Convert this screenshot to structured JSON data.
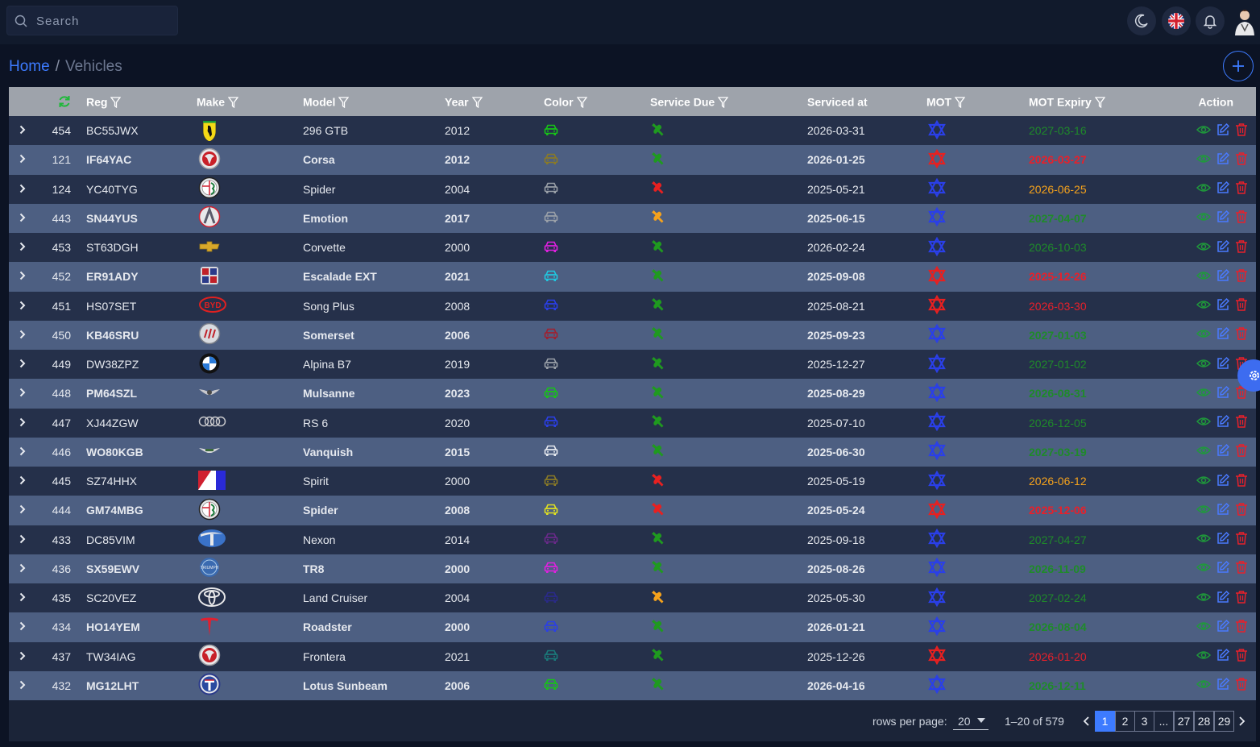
{
  "search": {
    "placeholder": "Search"
  },
  "topbar": {
    "icons": [
      "moon-icon",
      "uk-flag-icon",
      "bell-icon",
      "avatar"
    ]
  },
  "breadcrumb": {
    "home": "Home",
    "separator": "/",
    "current": "Vehicles"
  },
  "table": {
    "columns": [
      "Reg",
      "Make",
      "Model",
      "Year",
      "Color",
      "Service Due",
      "Serviced at",
      "MOT",
      "MOT Expiry",
      "Action"
    ],
    "rows": [
      {
        "id": "454",
        "reg": "BC55JWX",
        "make": "ferrari",
        "model": "296 GTB",
        "year": "2012",
        "car_color": "#17c417",
        "service": "#1f9a1f",
        "serviced": "2026-03-31",
        "mot": "#2a3fe8",
        "expiry": "2027-03-16",
        "exp": "green",
        "bold": false
      },
      {
        "id": "121",
        "reg": "IF64YAC",
        "make": "vauxhall",
        "model": "Corsa",
        "year": "2012",
        "car_color": "#8a7a26",
        "service": "#1f9a1f",
        "serviced": "2026-01-25",
        "mot": "#e82020",
        "expiry": "2026-03-27",
        "exp": "red",
        "bold": true
      },
      {
        "id": "124",
        "reg": "YC40TYG",
        "make": "alfa",
        "model": "Spider",
        "year": "2004",
        "car_color": "#9aa0a8",
        "service": "#e82020",
        "serviced": "2025-05-21",
        "mot": "#2a3fe8",
        "expiry": "2026-06-25",
        "exp": "orange",
        "bold": false
      },
      {
        "id": "443",
        "reg": "SN44YUS",
        "make": "aixam",
        "model": "Emotion",
        "year": "2017",
        "car_color": "#9aa0a8",
        "service": "#f5a21c",
        "serviced": "2025-06-15",
        "mot": "#2a3fe8",
        "expiry": "2027-04-07",
        "exp": "green",
        "bold": true
      },
      {
        "id": "453",
        "reg": "ST63DGH",
        "make": "chevrolet",
        "model": "Corvette",
        "year": "2000",
        "car_color": "#e020e0",
        "service": "#1f9a1f",
        "serviced": "2026-02-24",
        "mot": "#2a3fe8",
        "expiry": "2026-10-03",
        "exp": "green",
        "bold": false
      },
      {
        "id": "452",
        "reg": "ER91ADY",
        "make": "cadillac",
        "model": "Escalade EXT",
        "year": "2021",
        "car_color": "#20c8e0",
        "service": "#1f9a1f",
        "serviced": "2025-09-08",
        "mot": "#e82020",
        "expiry": "2025-12-26",
        "exp": "red",
        "bold": true
      },
      {
        "id": "451",
        "reg": "HS07SET",
        "make": "byd",
        "model": "Song Plus",
        "year": "2008",
        "car_color": "#2a3fe8",
        "service": "#1f9a1f",
        "serviced": "2025-08-21",
        "mot": "#e82020",
        "expiry": "2026-03-30",
        "exp": "red",
        "bold": false
      },
      {
        "id": "450",
        "reg": "KB46SRU",
        "make": "buick",
        "model": "Somerset",
        "year": "2006",
        "car_color": "#a02030",
        "service": "#1f9a1f",
        "serviced": "2025-09-23",
        "mot": "#2a3fe8",
        "expiry": "2027-01-03",
        "exp": "green",
        "bold": true
      },
      {
        "id": "449",
        "reg": "DW38ZPZ",
        "make": "bmw",
        "model": "Alpina B7",
        "year": "2019",
        "car_color": "#9aa0a8",
        "service": "#1f9a1f",
        "serviced": "2025-12-27",
        "mot": "#2a3fe8",
        "expiry": "2027-01-02",
        "exp": "green",
        "bold": false
      },
      {
        "id": "448",
        "reg": "PM64SZL",
        "make": "bentley",
        "model": "Mulsanne",
        "year": "2023",
        "car_color": "#17c417",
        "service": "#1f9a1f",
        "serviced": "2025-08-29",
        "mot": "#2a3fe8",
        "expiry": "2026-08-31",
        "exp": "green",
        "bold": true
      },
      {
        "id": "447",
        "reg": "XJ44ZGW",
        "make": "audi",
        "model": "RS 6",
        "year": "2020",
        "car_color": "#2a3fe8",
        "service": "#1f9a1f",
        "serviced": "2025-07-10",
        "mot": "#2a3fe8",
        "expiry": "2026-12-05",
        "exp": "green",
        "bold": false
      },
      {
        "id": "446",
        "reg": "WO80KGB",
        "make": "astonmartin",
        "model": "Vanquish",
        "year": "2015",
        "car_color": "#e6e9ef",
        "service": "#1f9a1f",
        "serviced": "2025-06-30",
        "mot": "#2a3fe8",
        "expiry": "2027-03-19",
        "exp": "green",
        "bold": true
      },
      {
        "id": "445",
        "reg": "SZ74HHX",
        "make": "amc",
        "model": "Spirit",
        "year": "2000",
        "car_color": "#8a7a26",
        "service": "#e82020",
        "serviced": "2025-05-19",
        "mot": "#2a3fe8",
        "expiry": "2026-06-12",
        "exp": "orange",
        "bold": false
      },
      {
        "id": "444",
        "reg": "GM74MBG",
        "make": "alfa",
        "model": "Spider",
        "year": "2008",
        "car_color": "#e0e020",
        "service": "#e82020",
        "serviced": "2025-05-24",
        "mot": "#e82020",
        "expiry": "2025-12-06",
        "exp": "red",
        "bold": true
      },
      {
        "id": "433",
        "reg": "DC85VIM",
        "make": "tata",
        "model": "Nexon",
        "year": "2014",
        "car_color": "#6a2a8a",
        "service": "#1f9a1f",
        "serviced": "2025-09-18",
        "mot": "#2a3fe8",
        "expiry": "2027-04-27",
        "exp": "green",
        "bold": false
      },
      {
        "id": "436",
        "reg": "SX59EWV",
        "make": "triumph",
        "model": "TR8",
        "year": "2000",
        "car_color": "#e020e0",
        "service": "#1f9a1f",
        "serviced": "2025-08-26",
        "mot": "#2a3fe8",
        "expiry": "2026-11-09",
        "exp": "green",
        "bold": true
      },
      {
        "id": "435",
        "reg": "SC20VEZ",
        "make": "toyota",
        "model": "Land Cruiser",
        "year": "2004",
        "car_color": "#2a2a8a",
        "service": "#f5a21c",
        "serviced": "2025-05-30",
        "mot": "#2a3fe8",
        "expiry": "2027-02-24",
        "exp": "green",
        "bold": false
      },
      {
        "id": "434",
        "reg": "HO14YEM",
        "make": "tesla",
        "model": "Roadster",
        "year": "2000",
        "car_color": "#2a3fe8",
        "service": "#1f9a1f",
        "serviced": "2026-01-21",
        "mot": "#2a3fe8",
        "expiry": "2026-08-04",
        "exp": "green",
        "bold": true
      },
      {
        "id": "437",
        "reg": "TW34IAG",
        "make": "vauxhall",
        "model": "Frontera",
        "year": "2021",
        "car_color": "#1a7a7a",
        "service": "#1f9a1f",
        "serviced": "2025-12-26",
        "mot": "#e82020",
        "expiry": "2026-01-20",
        "exp": "red",
        "bold": false
      },
      {
        "id": "432",
        "reg": "MG12LHT",
        "make": "talbot",
        "model": "Lotus Sunbeam",
        "year": "2006",
        "car_color": "#17c417",
        "service": "#1f9a1f",
        "serviced": "2026-04-16",
        "mot": "#2a3fe8",
        "expiry": "2026-12-11",
        "exp": "green",
        "bold": true
      }
    ]
  },
  "pagination": {
    "rows_per_page_label": "rows per page:",
    "rows_per_page": "20",
    "range": "1–20 of 579",
    "pages": [
      "1",
      "2",
      "3",
      "...",
      "27",
      "28",
      "29"
    ],
    "active_page": "1"
  },
  "colors": {
    "accent": "#3d7bff",
    "header": "#9ea3ab",
    "row_odd": "#25304a",
    "row_even": "#4d5f82"
  }
}
